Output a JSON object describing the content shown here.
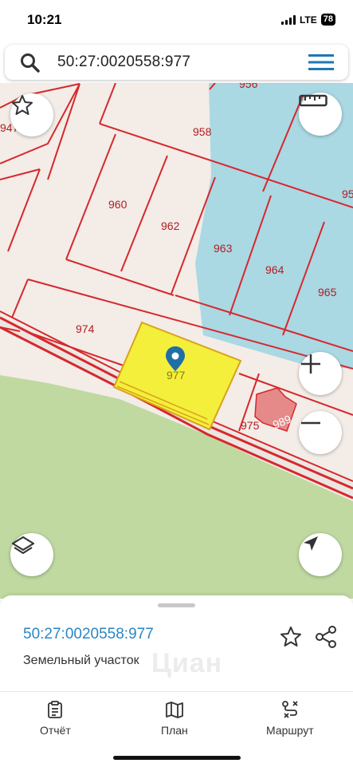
{
  "status": {
    "time": "10:21",
    "network": "LTE",
    "battery": "78"
  },
  "search": {
    "query": "50:27:0020558:977"
  },
  "map": {
    "parcels": [
      "956",
      "958",
      "960",
      "962",
      "963",
      "964",
      "965",
      "974",
      "977",
      "975",
      "989",
      "947",
      "95"
    ],
    "selected_parcel": "977"
  },
  "controls": [
    "favorite",
    "ruler",
    "zoom-in",
    "zoom-out",
    "layers",
    "locate"
  ],
  "sheet": {
    "title": "50:27:0020558:977",
    "subtitle": "Земельный участок",
    "watermark": "Циан"
  },
  "tabs": [
    {
      "label": "Отчёт",
      "icon": "report-icon"
    },
    {
      "label": "План",
      "icon": "map-icon"
    },
    {
      "label": "Маршрут",
      "icon": "route-icon"
    }
  ]
}
